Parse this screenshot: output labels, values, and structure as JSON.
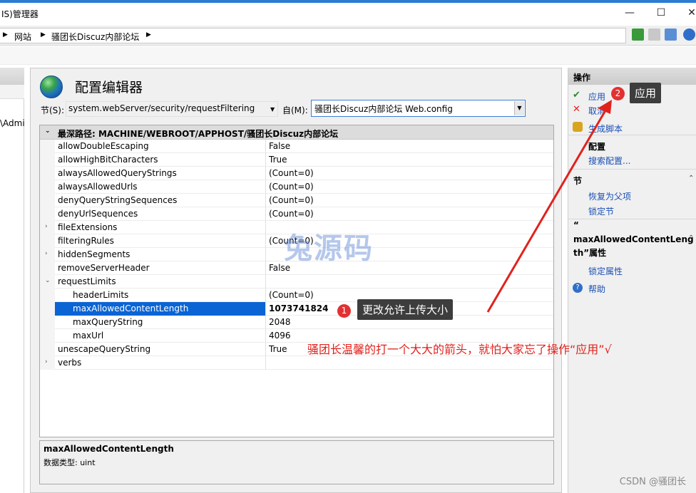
{
  "window": {
    "title": "IS)管理器",
    "min": "—",
    "max": "☐",
    "close": "✕"
  },
  "address": {
    "crumbs": [
      "网站",
      "骚团长Discuz内部论坛"
    ]
  },
  "left": {
    "text": "\\Admi"
  },
  "editor": {
    "title": "配置编辑器",
    "section_label": "节(S):",
    "section_value": "system.webServer/security/requestFiltering",
    "from_label": "自(M):",
    "from_value": "骚团长Discuz内部论坛 Web.config",
    "path_header": "最深路径: MACHINE/WEBROOT/APPHOST/骚团长Discuz内部论坛",
    "rows": [
      {
        "name": "allowDoubleEscaping",
        "value": "False"
      },
      {
        "name": "allowHighBitCharacters",
        "value": "True"
      },
      {
        "name": "alwaysAllowedQueryStrings",
        "value": "(Count=0)"
      },
      {
        "name": "alwaysAllowedUrls",
        "value": "(Count=0)"
      },
      {
        "name": "denyQueryStringSequences",
        "value": "(Count=0)"
      },
      {
        "name": "denyUrlSequences",
        "value": "(Count=0)"
      },
      {
        "name": "fileExtensions",
        "value": ""
      },
      {
        "name": "filteringRules",
        "value": "(Count=0)"
      },
      {
        "name": "hiddenSegments",
        "value": ""
      },
      {
        "name": "removeServerHeader",
        "value": "False"
      },
      {
        "name": "requestLimits",
        "value": ""
      },
      {
        "name": "headerLimits",
        "value": "(Count=0)"
      },
      {
        "name": "maxAllowedContentLength",
        "value": "1073741824"
      },
      {
        "name": "maxQueryString",
        "value": "2048"
      },
      {
        "name": "maxUrl",
        "value": "4096"
      },
      {
        "name": "unescapeQueryString",
        "value": "True"
      },
      {
        "name": "verbs",
        "value": ""
      }
    ],
    "desc_title": "maxAllowedContentLength",
    "desc_type": "数据类型: uint"
  },
  "actions": {
    "header": "操作",
    "apply": "应用",
    "cancel": "取消",
    "gen_script": "生成脚本",
    "config_header": "配置",
    "search_config": "搜索配置...",
    "section_header": "节",
    "revert_parent": "恢复为父项",
    "lock_section": "锁定节",
    "attr_quote": "“",
    "attr_name_1": "maxAllowedContentLeng",
    "attr_name_2": "th”属性",
    "lock_attr": "锁定属性",
    "help": "帮助"
  },
  "annotations": {
    "badge1": "1",
    "callout1": "更改允许上传大小",
    "badge2": "2",
    "callout2": "应用",
    "note": "骚团长温馨的打一个大大的箭头，就怕大家忘了操作“应用”√",
    "watermark": "兔源码",
    "footer": "CSDN @骚团长"
  },
  "colors": {
    "accent": "#0a64d4",
    "annotation_red": "#e0221d",
    "link": "#1a4fb5"
  }
}
